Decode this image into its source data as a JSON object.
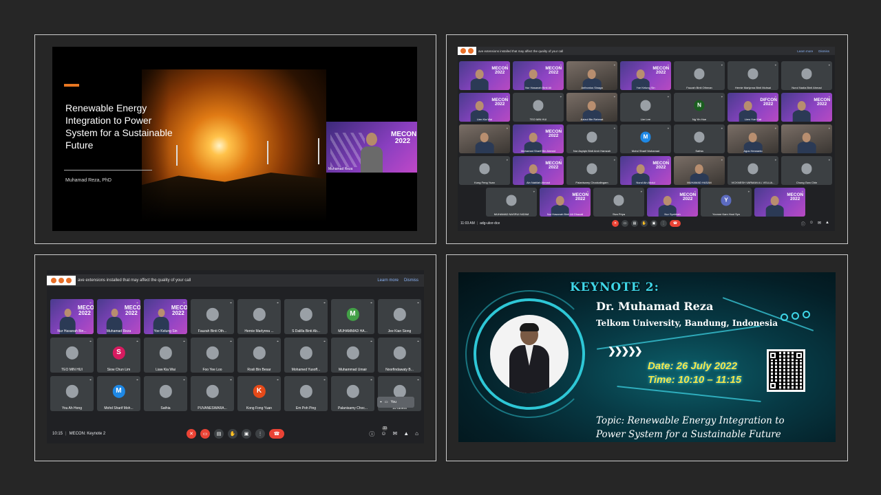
{
  "panel1": {
    "slide": {
      "title": "Renewable Energy Integration to Power System for a Sustainable Future",
      "author": "Muhamad Reza, PhD"
    },
    "speaker_tile": {
      "brand": "MECON 2022",
      "name": "Muhamad Reza"
    }
  },
  "panel2": {
    "warning": {
      "text": "ave extensions installed that may affect the quality of your call",
      "learn_more": "Learn more",
      "dismiss": "Dismiss"
    },
    "participants": [
      "",
      "Nur Hasanah Binti Ali",
      "Anthonius Sinaga",
      "Yoe Kelung Sin",
      "Fauzah Binti Othman",
      "Hernie Marlynna Binti Muhsal",
      "Nurul Nadia Binti Ahmad",
      "Lien Kia Wai",
      "TEO MIN HUI",
      "Azizul Bin Rahmat",
      "Lim Lee",
      "Ng Yin Hoe",
      "Liew Yue Kiat",
      "",
      "",
      "Mohamad Sharif Bin Ahmed",
      "Nur Asyiqin Binti Amir Hamzah",
      "Mohd Sharif Muhamad",
      "Sathia",
      "Agus Herwanto",
      "",
      "Kong Feng Yuan",
      "Ain Nabilah Ahmad",
      "Palanisamy Chockalingam",
      "Nurul Ain Abdul",
      "MUHAMAD HASAN",
      "VICKNESH VARMAN A L VELLIA...",
      "Chung Gwo Chin",
      "MUHAMAD NASRUI NIZAM",
      "Nur Hasanah Binti Ali Ghazali",
      "Siva Priya",
      "Nur Syahirah",
      "Yvonne Kam Hooi Syn",
      ""
    ],
    "brand": "MECON 2022",
    "brand_alt": "DIFCON 2022",
    "initials": {
      "n": "N",
      "m": "M",
      "y": "Y"
    },
    "time": "11:03 AM",
    "meeting_code": "adg-ukxr-dce"
  },
  "panel3": {
    "warning": {
      "text": "ave extensions installed that may affect the quality of your call",
      "learn_more": "Learn more",
      "dismiss": "Dismiss"
    },
    "participants": [
      "Nur Hasanah Bin...",
      "Muhamad Reza",
      "Yoe Kelung Sin",
      "Fauzah Binti Oth...",
      "Hernie Marlynna ...",
      "S Dalilla Binti Ab...",
      "MUHAMMAD HA...",
      "Jee Kian Siong",
      "TEO MIN HUI",
      "Siow Chun Lim",
      "Liaw Kia Wai",
      "Foo Yee Loo",
      "Rosli Bin Besar",
      "Mohamed Yusoff...",
      "Muhammad Umair",
      "Noorfindawaty B...",
      "You Ah Hong",
      "Mohd Sharif Moh...",
      "Sathia",
      "PUVANESWARA...",
      "Kong Fong Yuan",
      "Em Poh Ping",
      "Palanisamy Choc...",
      "10 others"
    ],
    "brand": "MECON 2022",
    "initials": {
      "m": "M",
      "s": "S",
      "k": "K"
    },
    "self_label": "You",
    "time": "10:15",
    "meeting_title": "MECON: Keynote 2",
    "people_count": "33"
  },
  "panel4": {
    "heading": "KEYNOTE 2:",
    "speaker": "Dr. Muhamad Reza",
    "affiliation": "Telkom University, Bandung, Indonesia",
    "date": "Date: 26 July 2022",
    "time": "Time: 10:10 – 11:15",
    "topic": "Topic: Renewable Energy Integration to Power System for a Sustainable Future"
  },
  "colors": {
    "accent": "#e87722",
    "meet_red": "#ea4335",
    "meet_bg": "#202124",
    "cyan": "#3fd7e8",
    "yellow": "#f7e64a"
  }
}
